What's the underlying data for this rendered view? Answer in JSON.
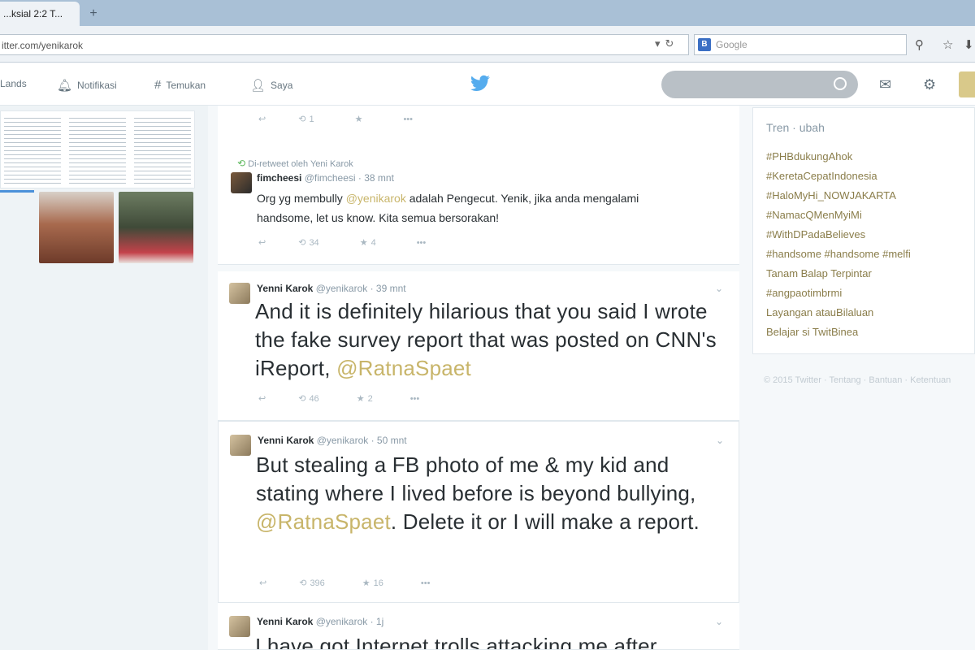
{
  "browser": {
    "tab_title": "...ksial 2:2 T...",
    "new_tab_symbol": "+",
    "url": "itter.com/yenikarok",
    "search_engine_letter": "B",
    "search_placeholder": "Google",
    "icons": [
      "reload-icon",
      "search-icon",
      "star-icon",
      "download-icon"
    ]
  },
  "twitter_nav": {
    "items": [
      {
        "label": "Lands",
        "icon": "home-icon"
      },
      {
        "label": "Notifikasi",
        "icon": "bell-icon"
      },
      {
        "label": "Temukan",
        "icon": "hashtag-icon"
      },
      {
        "label": "Saya",
        "icon": "user-icon"
      }
    ],
    "icons": [
      "twitter-bird-icon",
      "messages-icon",
      "settings-icon"
    ],
    "brand_color": "#55acee"
  },
  "timeline": {
    "top_actions": {
      "retweets": "1",
      "likes": ""
    },
    "retweeted": {
      "note": "Di-retweet oleh Yeni Karok",
      "name": "fimcheesi",
      "handle": "@fimcheesi",
      "time": "38 mnt",
      "text_before": "Org yg membully ",
      "mention": "@yenikarok",
      "text_after": " adalah Pengecut. Yenik, jika anda mengalami handsome, let us know. Kita semua bersorakan!",
      "retweets": "34",
      "likes": "4"
    },
    "tweets": [
      {
        "name": "Yenni Karok",
        "handle": "@yenikarok",
        "time": "39 mnt",
        "text_before": "And it is definitely hilarious that you said I wrote the fake survey report that was posted on CNN's iReport, ",
        "mention": "@RatnaSpaet",
        "text_after": "",
        "retweets": "46",
        "likes": "2"
      },
      {
        "name": "Yenni Karok",
        "handle": "@yenikarok",
        "time": "50 mnt",
        "text_before": "But stealing a FB photo of me & my kid and stating where I lived before is beyond bullying, ",
        "mention": "@RatnaSpaet",
        "text_after": ". Delete it or I will make a report.",
        "retweets": "396",
        "likes": "16"
      },
      {
        "name": "Yenni Karok",
        "handle": "@yenikarok",
        "time": "1j",
        "text_before": "I have got Internet trolls attacking me after",
        "mention": "",
        "text_after": "",
        "retweets": "",
        "likes": ""
      }
    ]
  },
  "trends": {
    "title": "Tren · ubah",
    "items": [
      "#PHBdukungAhok",
      "#KeretaCepatIndonesia",
      "#HaloMyHi_NOWJAKARTA",
      "#NamacQMenMyiMi",
      "#WithDPadaBelieves",
      "#handsome #handsome #melfi",
      "Tanam Balap Terpintar",
      "#angpaotimbrmi",
      "Layangan atauBilaluan",
      "Belajar si TwitBinea"
    ]
  },
  "footer": {
    "text": "© 2015 Twitter · Tentang · Bantuan · Ketentuan"
  }
}
